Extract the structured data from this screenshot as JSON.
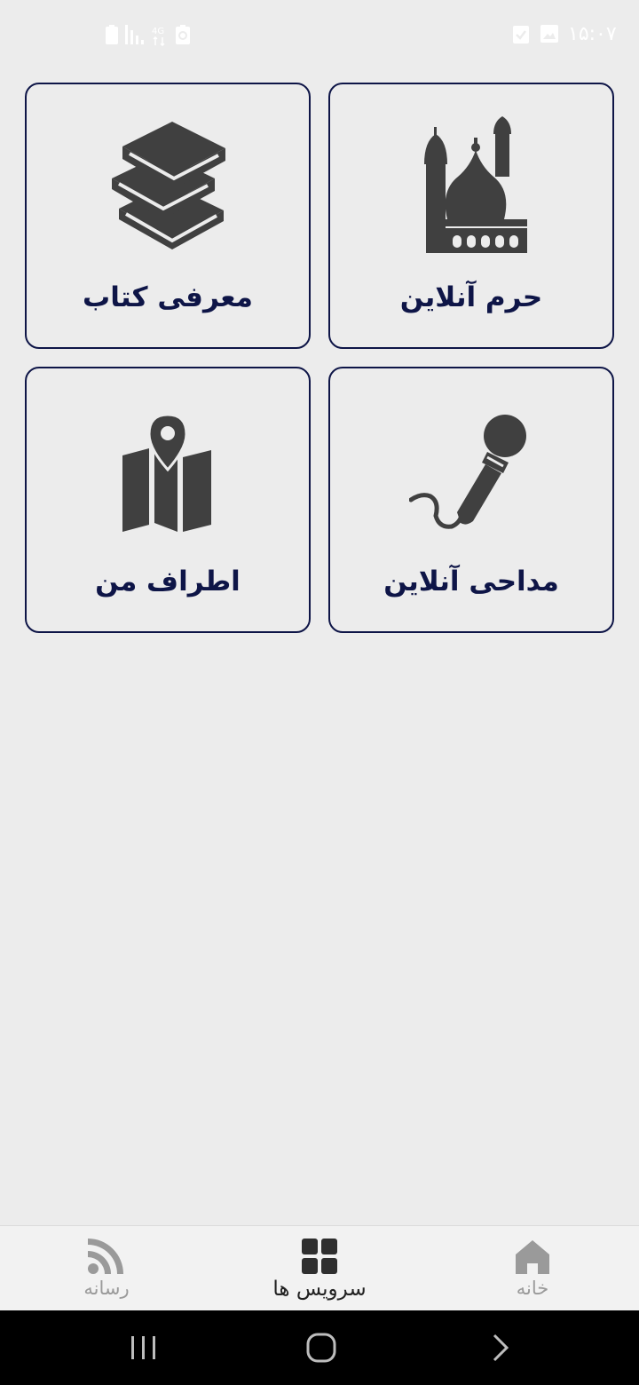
{
  "status_bar": {
    "time": "۱۵:۰۷",
    "icons": [
      "checkbox-notification-icon",
      "image-notification-icon",
      "battery-icon",
      "signal-icon",
      "network-4g-icon",
      "battery-saver-icon"
    ]
  },
  "services": [
    {
      "label": "حرم آنلاین",
      "icon": "shrine-mosque-icon"
    },
    {
      "label": "معرفی کتاب",
      "icon": "books-stack-icon"
    },
    {
      "label": "مداحی آنلاین",
      "icon": "microphone-icon"
    },
    {
      "label": "اطراف من",
      "icon": "map-pin-icon"
    }
  ],
  "bottom_nav": {
    "items": [
      {
        "label": "خانه",
        "icon": "home-icon",
        "active": false
      },
      {
        "label": "سرویس ها",
        "icon": "grid-icon",
        "active": true
      },
      {
        "label": "رسانه",
        "icon": "rss-feed-icon",
        "active": false
      }
    ]
  },
  "system_nav": {
    "buttons": [
      "recent-apps-icon",
      "home-circle-icon",
      "back-chevron-icon"
    ]
  },
  "colors": {
    "background": "#ececec",
    "card_border": "#0e1547",
    "label_text": "#0e1547",
    "icon_dark": "#404040",
    "nav_inactive": "#9a9a9a",
    "nav_active": "#222222"
  }
}
